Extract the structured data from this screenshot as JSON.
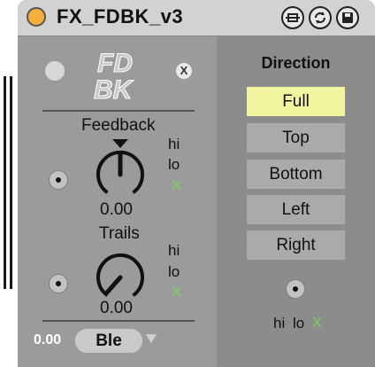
{
  "device": {
    "title": "FX_FDBK_v3",
    "logo_text_line1": "FD",
    "logo_text_line2": "BK",
    "logo_close": "X",
    "colors": {
      "power": "#f5b03a",
      "active": "#f1f5a0",
      "green": "#7ad65a"
    }
  },
  "title_icons": [
    "hot-swap-icon",
    "refresh-icon",
    "save-icon"
  ],
  "feedback": {
    "label": "Feedback",
    "value": "0.00",
    "hi": "hi",
    "lo": "lo",
    "x": "X"
  },
  "trails": {
    "label": "Trails",
    "value": "0.00",
    "hi": "hi",
    "lo": "lo",
    "x": "X"
  },
  "bottom": {
    "value": "0.00",
    "selector": "Ble"
  },
  "direction": {
    "title": "Direction",
    "options": [
      "Full",
      "Top",
      "Bottom",
      "Left",
      "Right"
    ],
    "selected": "Full",
    "hi": "hi",
    "lo": "lo",
    "x": "X"
  }
}
